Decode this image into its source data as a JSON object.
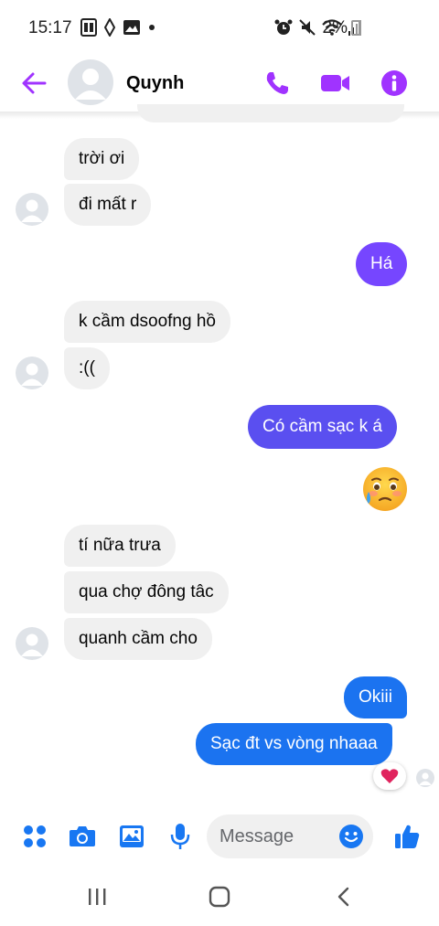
{
  "status_bar": {
    "time": "15:17",
    "battery": "2%"
  },
  "header": {
    "contact_name": "Quynh"
  },
  "messages": [
    {
      "text": "trời ơi",
      "side": "in"
    },
    {
      "text": "đi mất r",
      "side": "in"
    },
    {
      "text": "Há",
      "side": "out"
    },
    {
      "text": "k cầm dsoofng hồ",
      "side": "in"
    },
    {
      "text": ":((",
      "side": "in"
    },
    {
      "text": "Có cầm sạc k á",
      "side": "out"
    },
    {
      "text": "🥲",
      "side": "out",
      "kind": "emoji",
      "icon": "face-holding-back-tears-emoji"
    },
    {
      "text": "tí nữa trưa",
      "side": "in"
    },
    {
      "text": "qua chợ đông tâc",
      "side": "in"
    },
    {
      "text": "quanh cầm cho",
      "side": "in"
    },
    {
      "text": "Okiii",
      "side": "out"
    },
    {
      "text": "Sạc đt vs vòng nhaaa",
      "side": "out"
    }
  ],
  "reaction": {
    "icon": "heart-icon",
    "color": "#e0245e"
  },
  "composer": {
    "placeholder": "Message"
  },
  "colors": {
    "accent": "#a033ff",
    "outgoing_purple": "#7646ff",
    "outgoing_violet": "#5a4ff0",
    "outgoing_blue": "#1b73f0",
    "incoming_bg": "#f0f0f0",
    "composer_icons": "#1877f2"
  }
}
